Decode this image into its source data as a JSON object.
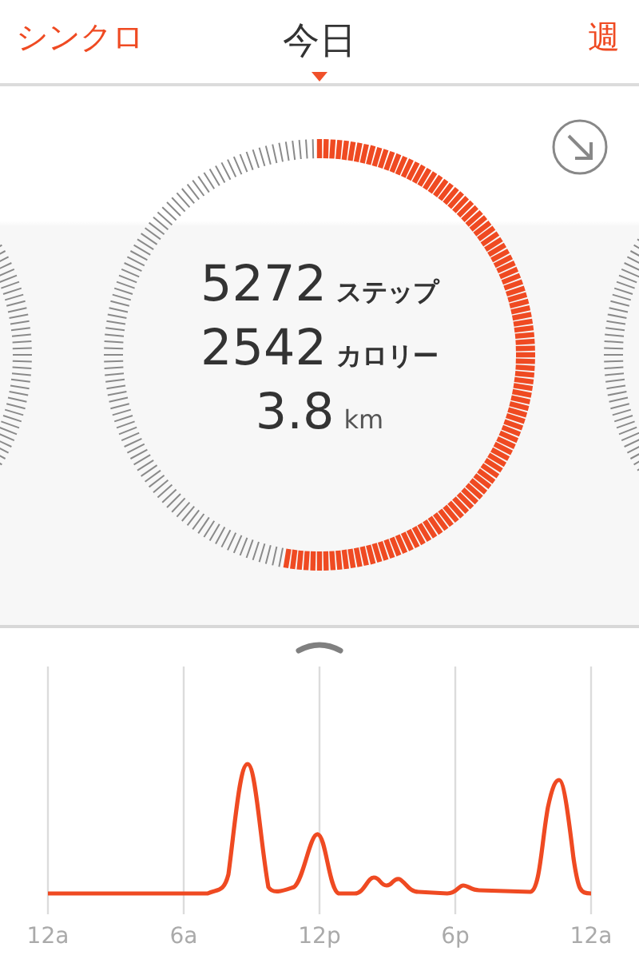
{
  "header": {
    "left_button": "シンクロ",
    "title": "今日",
    "right_button": "週"
  },
  "stats": [
    {
      "value": "5272",
      "unit": "ステップ",
      "kind": "jp"
    },
    {
      "value": "2542",
      "unit": "カロリー",
      "kind": "jp"
    },
    {
      "value": "3.8",
      "unit": "km",
      "kind": "latin"
    }
  ],
  "time_labels": [
    "12a",
    "6a",
    "12p",
    "6p",
    "12a"
  ]
}
